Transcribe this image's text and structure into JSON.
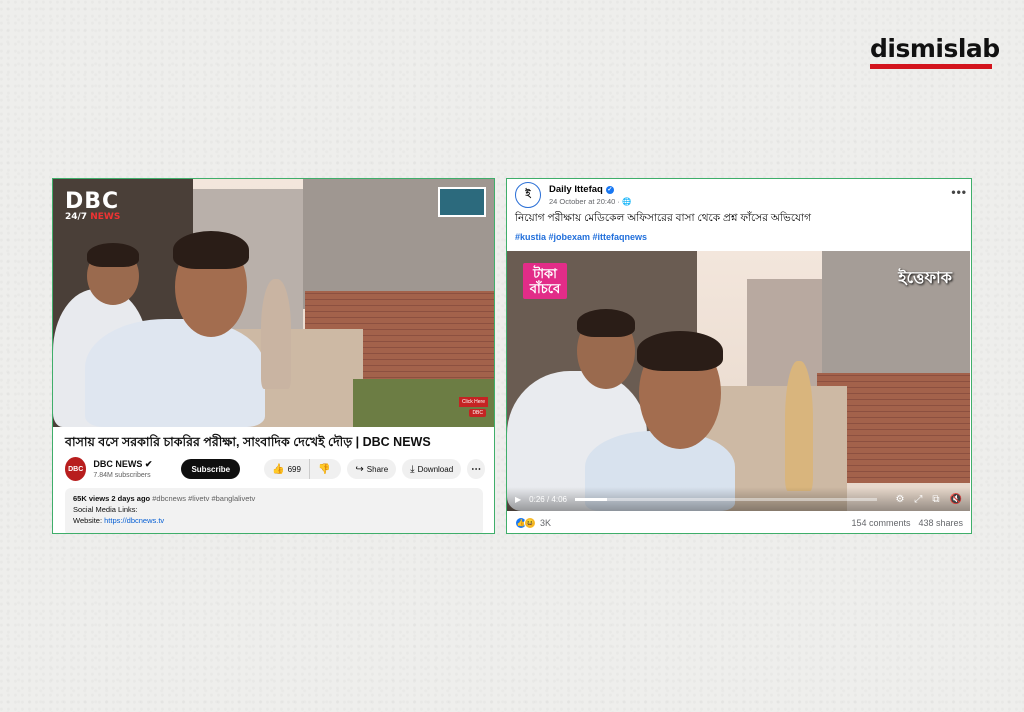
{
  "brand": {
    "name": "dismislab",
    "bar_color": "#d3141d"
  },
  "youtube": {
    "logo": {
      "main": "DBC",
      "sub_a": "24/7",
      "sub_b": "NEWS"
    },
    "click_here": "Click Here",
    "mini_logo": "DBC",
    "title": "বাসায় বসে সরকারি চাকরির পরীক্ষা, সাংবাদিক দেখেই দৌড় | DBC NEWS",
    "channel": {
      "avatar_text": "DBC",
      "name": "DBC NEWS",
      "subscribers": "7.84M subscribers"
    },
    "subscribe_label": "Subscribe",
    "like_count": "699",
    "share_label": "Share",
    "download_label": "Download",
    "description": {
      "views": "65K views",
      "age": "2 days ago",
      "tags": "#dbcnews #livetv #banglalivetv",
      "line2": "Social Media Links:",
      "website_label": "Website:",
      "website_link": "https://dbcnews.tv"
    }
  },
  "facebook": {
    "page_name": "Daily Ittefaq",
    "time": "24 October at 20:40 · ",
    "post_text": "নিয়োগ পরীক্ষায় মেডিকেল অফিসারের বাসা থেকে প্রশ্ন ফাঁসের অভিযোগ",
    "hashtags": "#kustia #jobexam #ittefaqnews",
    "video": {
      "overlay_left": "টাকা বাঁচবে",
      "overlay_right": "ইত্তেফাক",
      "time": "0:26 / 4:06",
      "progress": 0.106
    },
    "reactions_count": "3K",
    "comments": "154 comments",
    "shares": "438 shares"
  },
  "colors": {
    "frame": "#3fae6a",
    "fb_link": "#216fdb",
    "yt_link": "#065fd4"
  }
}
